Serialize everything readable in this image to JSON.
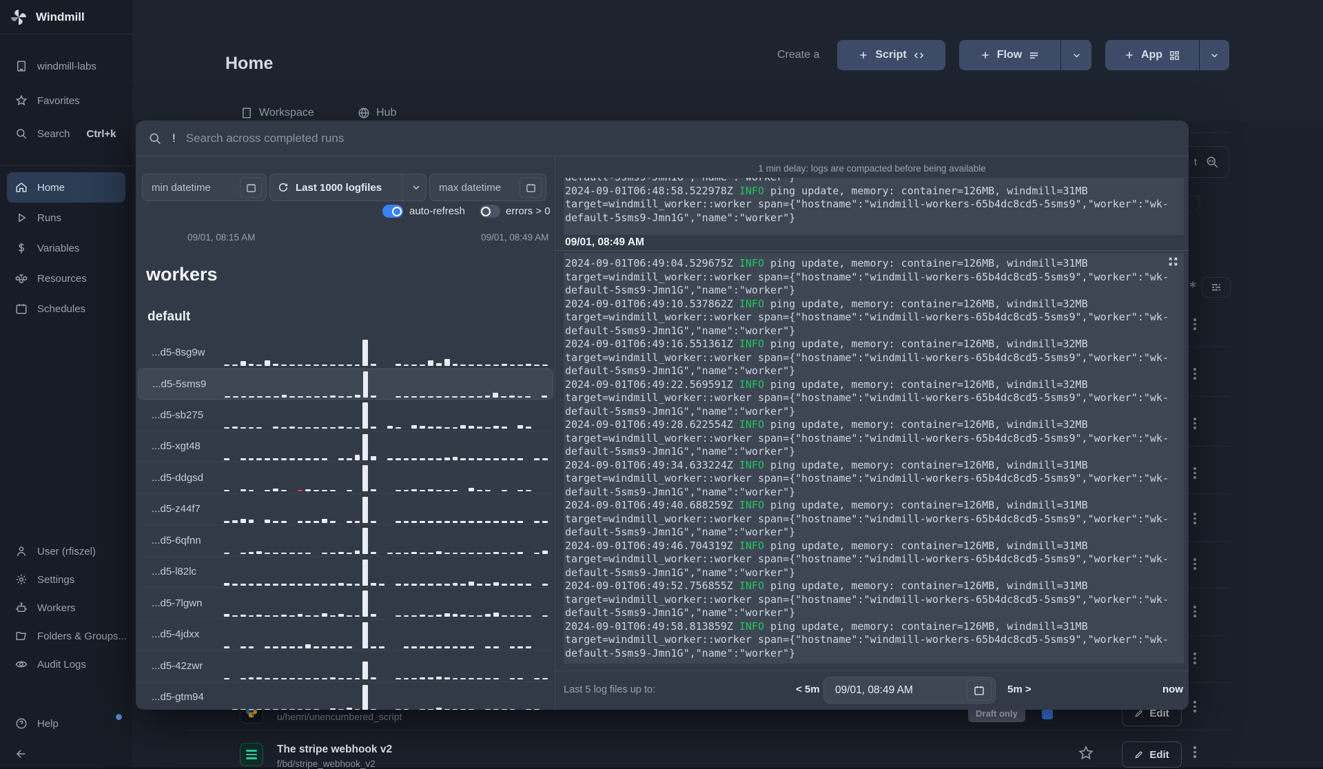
{
  "colors": {
    "accent": "#3b82f6",
    "info_green": "#22c55e",
    "bar": "#e9edf3",
    "bar_error": "#ef4444",
    "badge_bg": "#5b6178"
  },
  "sidebar": {
    "brand": "Windmill",
    "workspace": "windmill-labs",
    "favorites": "Favorites",
    "search": "Search",
    "search_kbd": "Ctrl+k",
    "home": "Home",
    "runs": "Runs",
    "variables": "Variables",
    "resources": "Resources",
    "schedules": "Schedules",
    "user": "User (rfiszel)",
    "settings": "Settings",
    "workers": "Workers",
    "folders": "Folders & Groups...",
    "audit": "Audit Logs",
    "help": "Help"
  },
  "header": {
    "title": "Home",
    "create": "Create a",
    "script": "Script",
    "flow": "Flow",
    "app": "App",
    "tab_workspace": "Workspace",
    "tab_hub": "Hub"
  },
  "background": {
    "search_fragment": "t",
    "rows": {
      "a_path": "u/henri/unencumbered_script",
      "a_badge": "Draft only",
      "b_title": "The stripe webhook v2",
      "b_path": "f/bd/stripe_webhook_v2",
      "edit": "Edit"
    },
    "kebab_ys": [
      462,
      534,
      606,
      678,
      744,
      810,
      879,
      947
    ],
    "divider_ys": [
      503,
      575,
      647,
      716,
      785,
      853,
      922,
      990
    ]
  },
  "modal": {
    "search": {
      "value": "!",
      "placeholder": "Search across completed runs"
    },
    "filters": {
      "min": "min datetime",
      "logfiles": "Last 1000 logfiles",
      "max": "max datetime",
      "auto_refresh": "auto-refresh",
      "auto_refresh_on": true,
      "errors": "errors > 0",
      "errors_on": false
    },
    "workers": {
      "time_start": "09/01, 08:15 AM",
      "time_end": "09/01, 08:49 AM",
      "title": "workers",
      "group": "default",
      "rows": [
        {
          "name": "...d5-8sg9w",
          "selected": false,
          "bars": [
            5,
            5,
            20,
            8,
            5,
            22,
            8,
            5,
            5,
            5,
            5,
            5,
            5,
            5,
            5,
            5,
            5,
            100,
            8,
            0,
            0,
            8,
            5,
            5,
            5,
            22,
            12,
            28,
            8,
            5,
            5,
            5,
            5,
            5,
            8,
            5,
            5,
            8,
            5,
            5
          ]
        },
        {
          "name": "...d5-5sms9",
          "selected": true,
          "bars": [
            5,
            5,
            5,
            5,
            5,
            5,
            5,
            12,
            5,
            5,
            5,
            5,
            5,
            8,
            5,
            5,
            10,
            100,
            8,
            0,
            0,
            5,
            5,
            5,
            5,
            5,
            5,
            5,
            5,
            5,
            5,
            5,
            8,
            18,
            5,
            8,
            5,
            5,
            0,
            8
          ]
        },
        {
          "name": "...d5-sb275",
          "selected": false,
          "bars": [
            5,
            8,
            5,
            5,
            5,
            0,
            8,
            5,
            8,
            5,
            5,
            5,
            5,
            5,
            8,
            5,
            5,
            100,
            8,
            0,
            12,
            5,
            0,
            14,
            10,
            8,
            8,
            5,
            5,
            14,
            10,
            8,
            5,
            12,
            8,
            0,
            14,
            8,
            0,
            0
          ]
        },
        {
          "name": "...d5-xgt48",
          "selected": false,
          "bars": [
            5,
            0,
            5,
            5,
            5,
            5,
            5,
            5,
            5,
            5,
            5,
            5,
            8,
            0,
            5,
            8,
            20,
            100,
            16,
            0,
            5,
            8,
            5,
            8,
            5,
            5,
            8,
            10,
            12,
            5,
            5,
            5,
            5,
            8,
            5,
            5,
            5,
            0,
            5,
            5
          ]
        },
        {
          "name": "...d5-ddgsd",
          "selected": false,
          "bars": [
            5,
            0,
            8,
            5,
            0,
            5,
            10,
            5,
            0,
            -6,
            8,
            5,
            5,
            5,
            0,
            5,
            0,
            100,
            8,
            0,
            0,
            5,
            5,
            8,
            5,
            8,
            5,
            5,
            5,
            0,
            14,
            5,
            5,
            0,
            5,
            0,
            5,
            5,
            0,
            0
          ]
        },
        {
          "name": "...d5-z44f7",
          "selected": false,
          "bars": [
            5,
            10,
            14,
            12,
            0,
            12,
            5,
            8,
            0,
            5,
            5,
            5,
            14,
            5,
            0,
            5,
            8,
            100,
            8,
            0,
            0,
            5,
            8,
            5,
            8,
            8,
            5,
            8,
            8,
            5,
            5,
            5,
            5,
            5,
            5,
            5,
            8,
            0,
            5,
            5
          ]
        },
        {
          "name": "...d5-6qfnn",
          "selected": false,
          "bars": [
            5,
            0,
            5,
            8,
            12,
            5,
            5,
            5,
            5,
            5,
            5,
            0,
            5,
            5,
            8,
            5,
            14,
            100,
            8,
            0,
            5,
            5,
            5,
            8,
            5,
            5,
            12,
            5,
            5,
            5,
            5,
            5,
            5,
            8,
            5,
            5,
            8,
            0,
            5,
            14
          ]
        },
        {
          "name": "...d5-l82lc",
          "selected": false,
          "bars": [
            10,
            8,
            5,
            5,
            5,
            8,
            5,
            5,
            5,
            5,
            5,
            5,
            5,
            5,
            10,
            8,
            8,
            100,
            10,
            8,
            0,
            5,
            8,
            5,
            5,
            5,
            8,
            5,
            10,
            8,
            14,
            5,
            8,
            12,
            5,
            8,
            5,
            5,
            0,
            5
          ]
        },
        {
          "name": "...d5-7lgwn",
          "selected": false,
          "bars": [
            12,
            5,
            8,
            5,
            8,
            5,
            5,
            8,
            5,
            10,
            5,
            5,
            14,
            5,
            10,
            5,
            5,
            100,
            10,
            0,
            0,
            5,
            5,
            5,
            8,
            5,
            8,
            14,
            12,
            8,
            5,
            5,
            10,
            16,
            5,
            5,
            5,
            5,
            0,
            5
          ]
        },
        {
          "name": "...d5-4jdxx",
          "selected": false,
          "bars": [
            5,
            0,
            5,
            5,
            0,
            8,
            5,
            5,
            5,
            5,
            14,
            5,
            5,
            5,
            5,
            5,
            0,
            100,
            8,
            5,
            0,
            0,
            8,
            5,
            8,
            5,
            5,
            5,
            5,
            8,
            5,
            0,
            5,
            5,
            0,
            5,
            5,
            5,
            0,
            0
          ]
        },
        {
          "name": "...d5-42zwr",
          "selected": false,
          "bars": [
            5,
            0,
            5,
            8,
            8,
            5,
            5,
            5,
            5,
            5,
            5,
            5,
            5,
            8,
            5,
            5,
            5,
            70,
            8,
            0,
            0,
            5,
            5,
            5,
            8,
            8,
            10,
            8,
            5,
            5,
            5,
            5,
            5,
            5,
            0,
            5,
            5,
            0,
            5,
            5
          ]
        },
        {
          "name": "...d5-gtm94",
          "selected": false,
          "bars": [
            0,
            5,
            5,
            5,
            5,
            5,
            5,
            5,
            5,
            5,
            5,
            5,
            0,
            10,
            5,
            12,
            8,
            100,
            8,
            0,
            0,
            5,
            5,
            0,
            5,
            5,
            12,
            5,
            5,
            5,
            5,
            0,
            5,
            8,
            8,
            5,
            0,
            5,
            5,
            0
          ]
        }
      ]
    },
    "logs": {
      "delay_notice": "1 min delay: logs are compacted before being available",
      "date_header": "09/01, 08:49 AM",
      "info": "INFO",
      "msg_a": " ping update, memory: container=126MB, windmill=",
      "line_target": "target=windmill_worker::worker span={\"hostname\":\"windmill-workers-65b4dc8cd5-5sms9\",\"worker\":\"wk-",
      "line_default": "default-5sms9-Jmn1G\",\"name\":\"worker\"}",
      "first": {
        "ts": "2024-09-01T06:48:58.522978Z",
        "mem": "31MB"
      },
      "entries": [
        {
          "ts": "2024-09-01T06:49:04.529675Z",
          "mem": "31MB"
        },
        {
          "ts": "2024-09-01T06:49:10.537862Z",
          "mem": "32MB"
        },
        {
          "ts": "2024-09-01T06:49:16.551361Z",
          "mem": "32MB"
        },
        {
          "ts": "2024-09-01T06:49:22.569591Z",
          "mem": "32MB"
        },
        {
          "ts": "2024-09-01T06:49:28.622554Z",
          "mem": "32MB"
        },
        {
          "ts": "2024-09-01T06:49:34.633224Z",
          "mem": "31MB"
        },
        {
          "ts": "2024-09-01T06:49:40.688259Z",
          "mem": "31MB"
        },
        {
          "ts": "2024-09-01T06:49:46.704319Z",
          "mem": "31MB"
        },
        {
          "ts": "2024-09-01T06:49:52.756855Z",
          "mem": "31MB"
        },
        {
          "ts": "2024-09-01T06:49:58.813859Z",
          "mem": "31MB"
        }
      ],
      "footer": {
        "label": "Last 5 log files up to:",
        "back": "< 5m",
        "datetime": "09/01, 08:49 AM",
        "fwd": "5m >",
        "now": "now"
      }
    }
  }
}
